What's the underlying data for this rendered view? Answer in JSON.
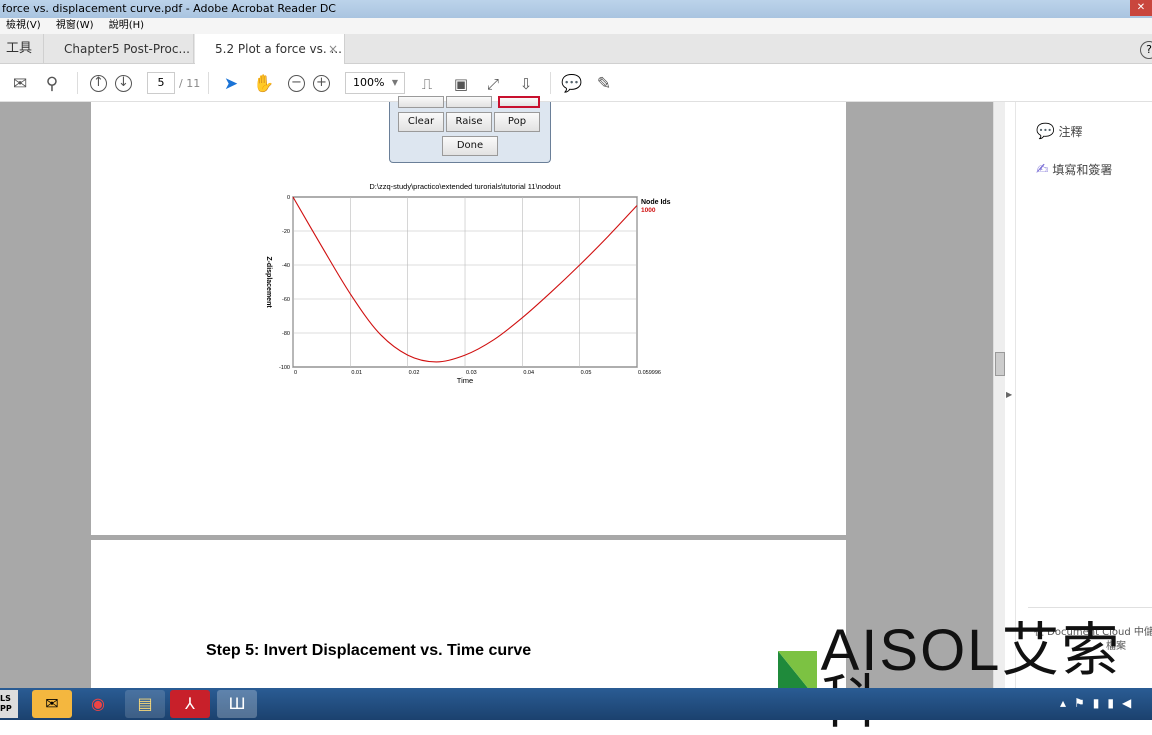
{
  "window": {
    "title": "force vs. displacement curve.pdf - Adobe Acrobat Reader DC",
    "close": "✕"
  },
  "menu": [
    "檢視(V)",
    "視窗(W)",
    "說明(H)"
  ],
  "tabs": [
    {
      "label": "工具"
    },
    {
      "label": "Chapter5 Post-Proc..."
    },
    {
      "label": "5.2 Plot a force vs. ...",
      "close": "×"
    }
  ],
  "help": "?",
  "toolbar": {
    "page_current": "5",
    "page_total": "/ 11",
    "zoom": "100%"
  },
  "dialog": {
    "buttons": [
      "Clear",
      "Raise",
      "Pop",
      "Done"
    ]
  },
  "document": {
    "step_heading": "Step 5: Invert Displacement vs. Time curve"
  },
  "panel": {
    "items": [
      {
        "label": "注釋",
        "icon": "comment-icon",
        "color": "#f5c242"
      },
      {
        "label": "填寫和簽署",
        "icon": "sign-icon",
        "color": "#7b6fd6"
      }
    ],
    "cloud_text": "在 Document Cloud 中儲",
    "cloud_text2": "檔案"
  },
  "watermark": {
    "logo": "AISOL艾索科"
  },
  "taskbar": {
    "start_label": "LS PP",
    "apps": [
      "outlook-icon",
      "chrome-icon",
      "folder-icon",
      "acrobat-icon",
      "app-icon"
    ]
  },
  "chart_data": {
    "type": "line",
    "title": "D:\\zzq-study\\practico\\extended turorials\\tutorial 11\\nodout",
    "xlabel": "Time",
    "ylabel": "Z-displacement",
    "xlim": [
      0,
      0.059996
    ],
    "ylim": [
      -100,
      0
    ],
    "xticks": [
      "0",
      "0.01",
      "0.02",
      "0.03",
      "0.04",
      "0.05",
      "0.059996"
    ],
    "yticks": [
      "0",
      "-20",
      "-40",
      "-60",
      "-80",
      "-100"
    ],
    "grid": true,
    "legend": {
      "title": "Node Ids",
      "placement": "right"
    },
    "series": [
      {
        "name": "1000",
        "color": "#d01010",
        "x": [
          0,
          0.005,
          0.01,
          0.015,
          0.02,
          0.025,
          0.03,
          0.035,
          0.04,
          0.045,
          0.05,
          0.055,
          0.059996
        ],
        "y": [
          0,
          -29,
          -57,
          -80,
          -93,
          -97,
          -93,
          -84,
          -71,
          -56,
          -40,
          -23,
          -5
        ]
      }
    ]
  }
}
